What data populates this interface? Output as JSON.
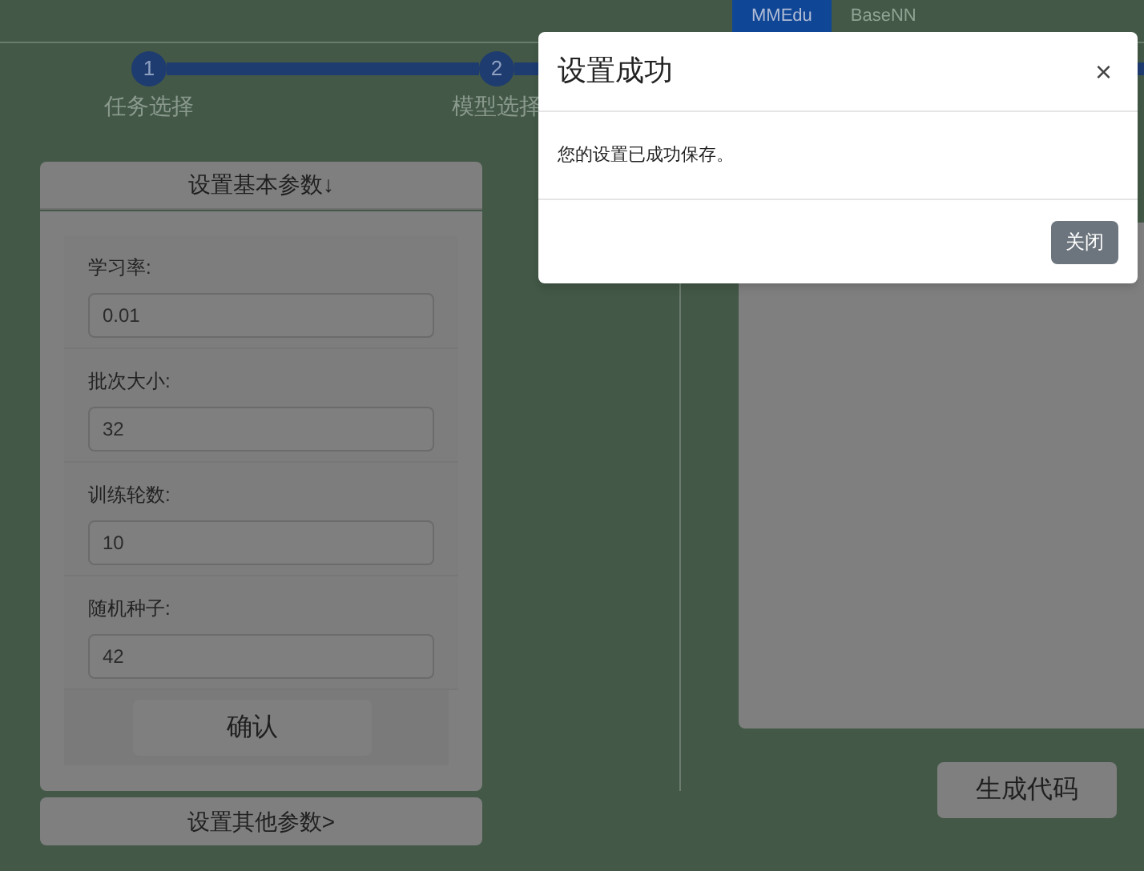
{
  "tabs": [
    {
      "label": "MMEdu",
      "selected": true
    },
    {
      "label": "BaseNN",
      "selected": false
    }
  ],
  "stepper": [
    {
      "number": "1",
      "label": "任务选择"
    },
    {
      "number": "2",
      "label": "模型选择"
    }
  ],
  "basic_params": {
    "toggle": "设置基本参数↓",
    "fields": [
      {
        "label": "学习率:",
        "value": "0.01"
      },
      {
        "label": "批次大小:",
        "value": "32"
      },
      {
        "label": "训练轮数:",
        "value": "10"
      },
      {
        "label": "随机种子:",
        "value": "42"
      }
    ],
    "confirm": "确认"
  },
  "other_params_toggle": "设置其他参数>",
  "generate_button": "生成代码",
  "dialog": {
    "title": "设置成功",
    "close": "×",
    "message": "您的设置已成功保存。",
    "button": "关闭"
  }
}
